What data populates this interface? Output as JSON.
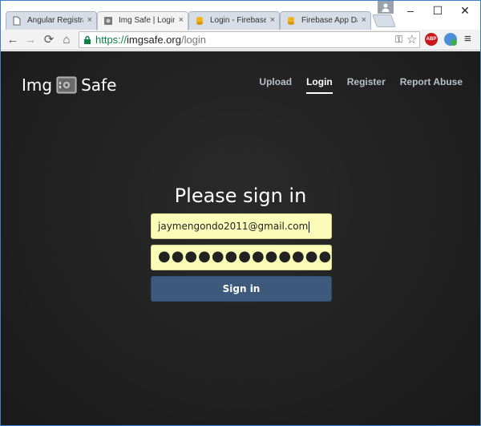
{
  "browser": {
    "tabs": [
      {
        "label": "Angular Registrati",
        "icon": "page-icon",
        "active": false
      },
      {
        "label": "Img Safe | Login |",
        "icon": "safe-icon",
        "active": true
      },
      {
        "label": "Login - Firebase",
        "icon": "firebase-icon",
        "active": false
      },
      {
        "label": "Firebase App Da",
        "icon": "firebase-icon",
        "active": false
      }
    ],
    "tab_close": "×",
    "window_controls": {
      "minimize": "–",
      "maximize": "☐",
      "close": "✕"
    },
    "toolbar": {
      "back": "←",
      "forward": "→",
      "reload": "⟳",
      "home": "⌂",
      "url_scheme": "https://",
      "url_host": "imgsafe.org",
      "url_path": "/login",
      "key": "⚿",
      "star": "☆",
      "abp_label": "ABP",
      "menu": "≡"
    },
    "colors": {
      "window_border": "#3f7fc9",
      "secure": "#0b8043",
      "abp": "#c7171c"
    }
  },
  "site": {
    "brand_left": "Img",
    "brand_right": "Safe",
    "nav": [
      {
        "label": "Upload",
        "active": false
      },
      {
        "label": "Login",
        "active": true
      },
      {
        "label": "Register",
        "active": false
      },
      {
        "label": "Report Abuse",
        "active": false
      }
    ]
  },
  "login": {
    "heading": "Please sign in",
    "email_value": "jaymengondo2011@gmail.com",
    "password_mask": "●●●●●●●●●●●●●",
    "submit_label": "Sign in",
    "colors": {
      "input_bg": "#fcfcb9",
      "button_bg": "#3d5a7d",
      "page_bg": "#222222"
    }
  }
}
